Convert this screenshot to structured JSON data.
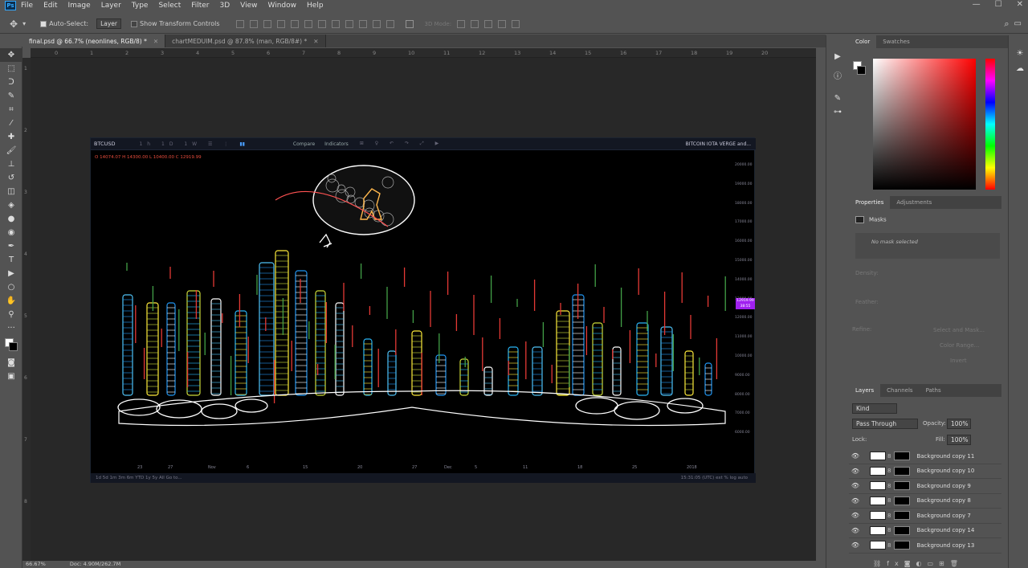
{
  "app": {
    "logo": "Ps"
  },
  "menu": [
    "File",
    "Edit",
    "Image",
    "Layer",
    "Type",
    "Select",
    "Filter",
    "3D",
    "View",
    "Window",
    "Help"
  ],
  "options": {
    "auto_select_label": "Auto-Select:",
    "auto_select_value": "Layer",
    "transform_label": "Show Transform Controls",
    "mode_3d": "3D Mode:"
  },
  "tabs": [
    {
      "label": "final.psd @ 66.7% (neonlines, RGB/8) *",
      "active": true
    },
    {
      "label": "chartMEDUIM.psd @ 87.8% (man, RGB/8#) *",
      "active": false
    }
  ],
  "ruler": {
    "top": [
      "0",
      "1",
      "2",
      "3",
      "4",
      "5",
      "6",
      "7",
      "8",
      "9",
      "10",
      "11",
      "12",
      "13",
      "14",
      "15",
      "16",
      "17",
      "18",
      "19",
      "20"
    ],
    "left": [
      "1",
      "2",
      "3",
      "4",
      "5",
      "6",
      "7",
      "8"
    ]
  },
  "chart": {
    "symbol": "BTCUSD",
    "ohlc": "O 14074.07  H 14300.00  L 10400.00  C 12919.99",
    "toolbar": {
      "compare": "Compare",
      "indicators": "Indicators",
      "title": "BITCOIN IOTA VERGE and..."
    },
    "price_axis": [
      "20000.00",
      "19000.00",
      "18000.00",
      "17000.00",
      "16000.00",
      "15000.00",
      "14000.00",
      "13000.00",
      "12000.00",
      "11000.00",
      "10000.00",
      "9000.00",
      "8000.00",
      "7000.00",
      "6000.00"
    ],
    "current_price": "12919.99",
    "current_time": "38:55",
    "time_axis": [
      "23",
      "27",
      "Nov",
      "6",
      "15",
      "20",
      "27",
      "Dec",
      "5",
      "11",
      "18",
      "25",
      "2018"
    ],
    "bottom_bar": "1d   5d   1m   3m   6m   YTD   1y   5y   All   Go to...",
    "bottom_right": "15:31:05 (UTC)    ext    %    log    auto"
  },
  "status": {
    "zoom": "66.67%",
    "doc": "Doc: 4.90M/262.7M"
  },
  "color_panel": {
    "tabs": [
      "Color",
      "Swatches"
    ],
    "hue_top": "#ff0000"
  },
  "properties": {
    "tabs": [
      "Properties",
      "Adjustments"
    ],
    "section": "Masks",
    "no_mask": "No mask selected",
    "density": "Density:",
    "feather": "Feather:",
    "refine": "Refine:",
    "select_mask": "Select and Mask...",
    "color_range": "Color Range...",
    "invert": "Invert"
  },
  "layers_panel": {
    "tabs": [
      "Layers",
      "Channels",
      "Paths"
    ],
    "kind": "Kind",
    "blend": "Pass Through",
    "opacity_label": "Opacity:",
    "opacity": "100%",
    "lock_label": "Lock:",
    "fill_label": "Fill:",
    "fill": "100%",
    "layers": [
      "Background copy 11",
      "Background copy 10",
      "Background copy 9",
      "Background copy 8",
      "Background copy 7",
      "Background copy 14",
      "Background copy 13"
    ]
  }
}
